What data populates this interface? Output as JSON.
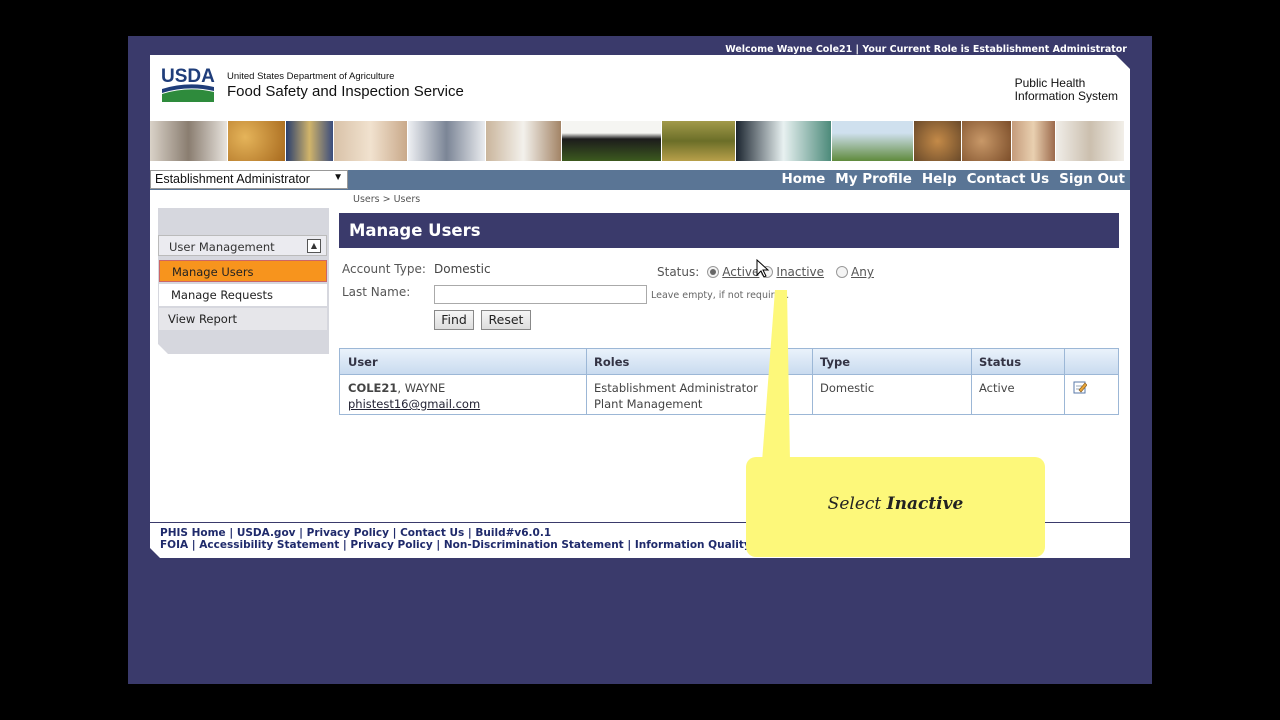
{
  "welcome_bar": "Welcome Wayne Cole21  |  Your Current Role is Establishment Administrator",
  "header": {
    "logo_text": "USDA",
    "agency_small": "United States Department of Agriculture",
    "agency_big": "Food Safety and Inspection Service",
    "system_line1": "Public Health",
    "system_line2": "Information System"
  },
  "role_selector": {
    "value": "Establishment Administrator"
  },
  "nav": [
    "Home",
    "My Profile",
    "Help",
    "Contact Us",
    "Sign Out"
  ],
  "breadcrumb": "Users > Users",
  "sidebar": {
    "section": "User Management",
    "items": [
      "Manage Users",
      "Manage Requests",
      "View Report"
    ]
  },
  "main": {
    "title": "Manage Users",
    "account_type_label": "Account Type:",
    "account_type_value": "Domestic",
    "status_label": "Status:",
    "status_options": [
      "Active",
      "Inactive",
      "Any"
    ],
    "status_selected": "Active",
    "last_name_label": "Last Name:",
    "last_name_value": "",
    "hint": "Leave empty, if not required.",
    "find_label": "Find",
    "reset_label": "Reset"
  },
  "table": {
    "columns": [
      "User",
      "Roles",
      "Type",
      "Status"
    ],
    "rows": [
      {
        "user_id": "COLE21",
        "user_name": ", WAYNE",
        "email": "phistest16@gmail.com",
        "roles": [
          "Establishment Administrator",
          "Plant Management"
        ],
        "type": "Domestic",
        "status": "Active"
      }
    ]
  },
  "footer": {
    "line1": "PHIS Home | USDA.gov | Privacy Policy | Contact Us | Build#v6.0.1",
    "line2": "FOIA | Accessibility Statement | Privacy Policy | Non-Discrimination Statement | Information Quality | U"
  },
  "callout": {
    "prefix": "Select ",
    "emphasis": "Inactive"
  },
  "colors": {
    "frame": "#3a3a6b",
    "navbar": "#5a7595",
    "active_item": "#f7941d",
    "callout": "#fdf87a"
  }
}
